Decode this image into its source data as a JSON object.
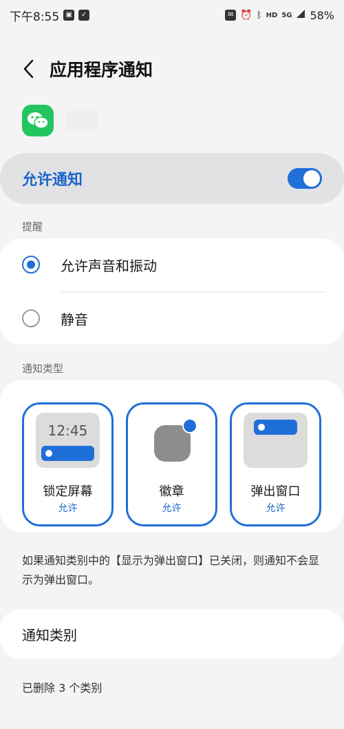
{
  "status_bar": {
    "time": "下午8:55",
    "hd": "HD",
    "network": "5G",
    "battery": "58%"
  },
  "header": {
    "title": "应用程序通知"
  },
  "app": {
    "icon": "wechat-icon",
    "color": "#22c55e"
  },
  "allow": {
    "label": "允许通知",
    "enabled": true,
    "accent": "#1f6fd9"
  },
  "reminder": {
    "section_label": "提醒",
    "options": [
      {
        "label": "允许声音和振动",
        "selected": true
      },
      {
        "label": "静音",
        "selected": false
      }
    ]
  },
  "notification_types": {
    "section_label": "通知类型",
    "lock_time": "12:45",
    "tiles": [
      {
        "title": "锁定屏幕",
        "status": "允许"
      },
      {
        "title": "徽章",
        "status": "允许"
      },
      {
        "title": "弹出窗口",
        "status": "允许"
      }
    ]
  },
  "info": {
    "text": "如果通知类别中的【显示为弹出窗口】已关闭，则通知不会显示为弹出窗口。"
  },
  "categories": {
    "label": "通知类别",
    "deleted_text": "已删除 3 个类别"
  }
}
